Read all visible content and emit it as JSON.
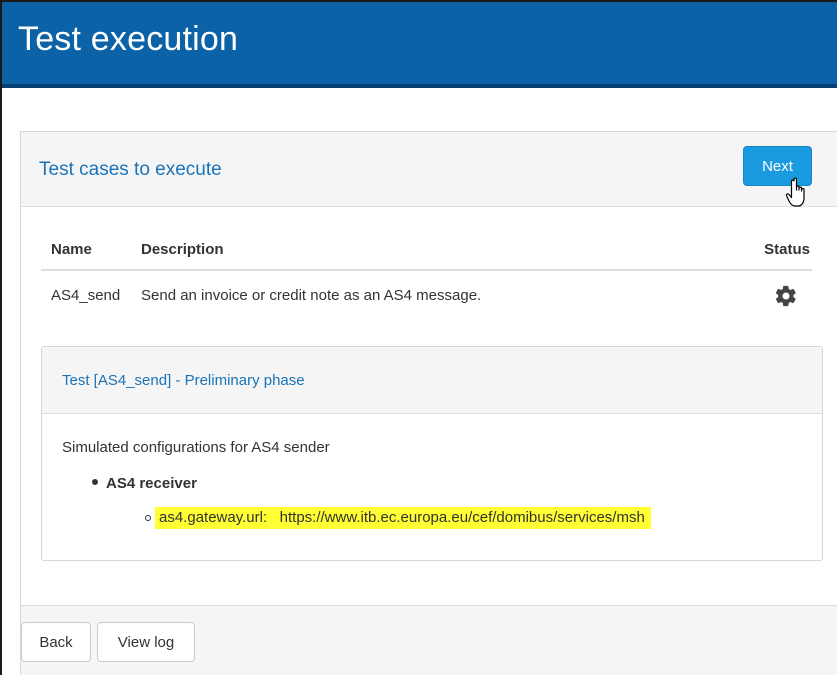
{
  "header": {
    "title": "Test execution"
  },
  "panel": {
    "title": "Test cases to execute",
    "next_label": "Next"
  },
  "table": {
    "columns": {
      "name": "Name",
      "description": "Description",
      "status": "Status"
    },
    "rows": [
      {
        "name": "AS4_send",
        "description": "Send an invoice or credit note as an AS4 message.",
        "status_icon": "gear-icon"
      }
    ]
  },
  "preliminary": {
    "title": "Test [AS4_send] - Preliminary phase",
    "intro": "Simulated configurations for AS4 sender",
    "group_label": "AS4 receiver",
    "config_key": "as4.gateway.url:",
    "config_value": "https://www.itb.ec.europa.eu/cef/domibus/services/msh"
  },
  "footer": {
    "back_label": "Back",
    "view_log_label": "View log"
  },
  "colors": {
    "header_bg": "#0b62a6",
    "accent": "#1a9be0",
    "link": "#1a73b8",
    "highlight": "#ffff33"
  }
}
